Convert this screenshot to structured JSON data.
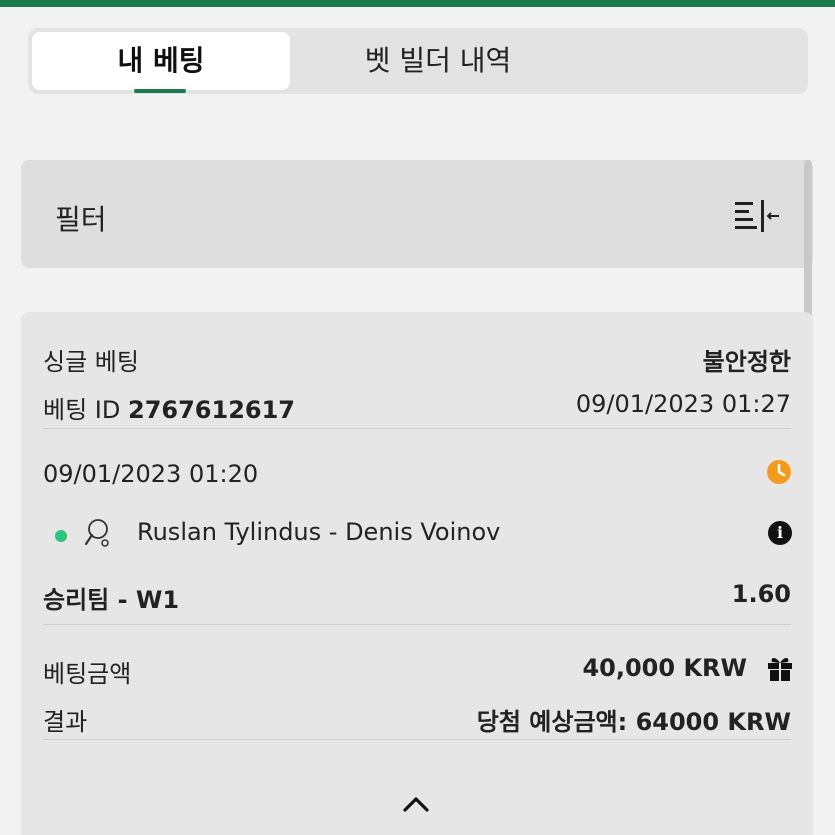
{
  "tabs": {
    "active": "내 베팅",
    "inactive": "벳 빌더 내역"
  },
  "filter": {
    "label": "필터"
  },
  "bet": {
    "type": "싱글 베팅",
    "status": "불안정한",
    "id_label": "베팅 ID",
    "id_value": "2767612617",
    "placed_at": "09/01/2023 01:27",
    "event_time": "09/01/2023 01:20",
    "event_name": "Ruslan Tylindus - Denis Voinov",
    "market": "승리팀 - W1",
    "odds": "1.60",
    "stake_label": "베팅금액",
    "stake_value": "40,000 KRW",
    "result_label": "결과",
    "result_value": "당첨 예상금액: 64000 KRW"
  },
  "colors": {
    "accent": "#1d7a4f",
    "live_dot": "#2ec27e",
    "clock": "#f39a1f"
  },
  "icons": [
    "filter-collapse-icon",
    "clock-icon",
    "table-tennis-icon",
    "info-icon",
    "gift-icon",
    "chevron-up-icon"
  ]
}
